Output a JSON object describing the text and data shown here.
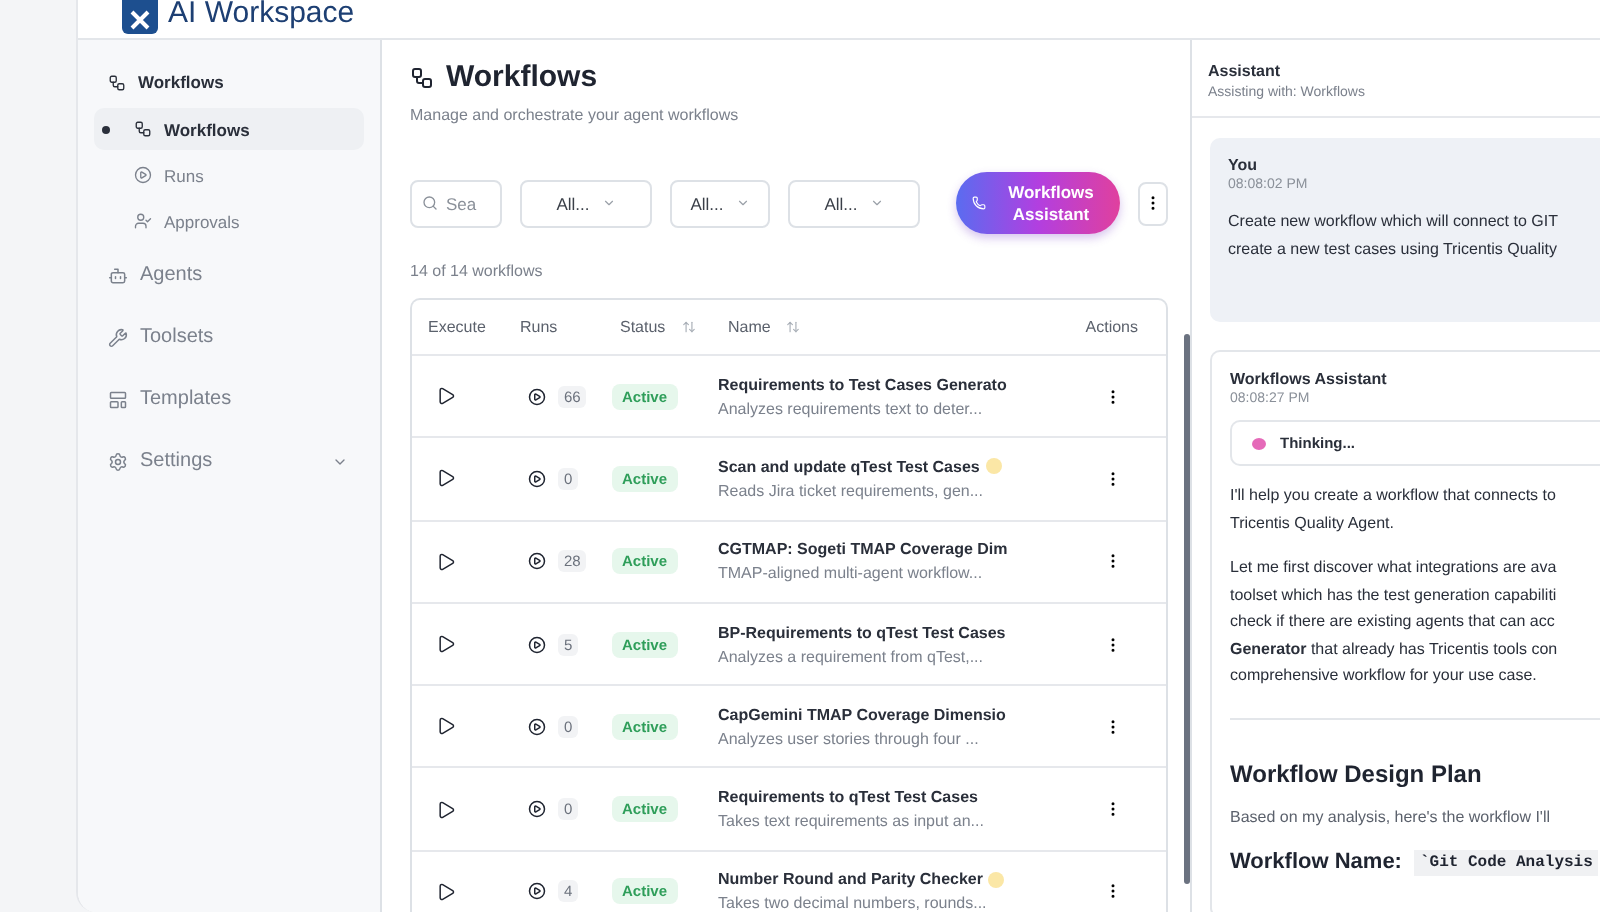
{
  "app": {
    "title": "AI Workspace"
  },
  "sidebar": {
    "items": [
      {
        "label": "Workflows",
        "children": [
          {
            "label": "Workflows",
            "selected": true
          },
          {
            "label": "Runs",
            "selected": false
          },
          {
            "label": "Approvals",
            "selected": false
          }
        ]
      },
      {
        "label": "Agents",
        "selected": false
      },
      {
        "label": "Toolsets",
        "selected": false
      },
      {
        "label": "Templates",
        "selected": false
      },
      {
        "label": "Settings",
        "selected": false,
        "expanded": false
      }
    ]
  },
  "main": {
    "title": "Workflows",
    "subtitle": "Manage and orchestrate your agent workflows",
    "search": {
      "placeholder": "Sea"
    },
    "filters": [
      "All...",
      "All...",
      "All..."
    ],
    "assistant_button": "Workflows Assistant",
    "count": "14 of 14 workflows",
    "table": {
      "columns": [
        {
          "label": "Execute",
          "sortable": false
        },
        {
          "label": "Runs",
          "sortable": false
        },
        {
          "label": "Status",
          "sortable": true
        },
        {
          "label": "Name",
          "sortable": true
        },
        {
          "label": "Actions",
          "sortable": false
        }
      ],
      "rows": [
        {
          "runs": "66",
          "status": "Active",
          "name": "Requirements to Test Cases Generato",
          "description": "Analyzes requirements text to deter...",
          "badge": false
        },
        {
          "runs": "0",
          "status": "Active",
          "name": "Scan and update qTest Test Cases",
          "description": "Reads Jira ticket requirements, gen...",
          "badge": true
        },
        {
          "runs": "28",
          "status": "Active",
          "name": "CGTMAP: Sogeti TMAP Coverage Dim",
          "description": "TMAP-aligned multi-agent workflow...",
          "badge": false
        },
        {
          "runs": "5",
          "status": "Active",
          "name": "BP-Requirements to qTest Test Cases",
          "description": "Analyzes a requirement from qTest,...",
          "badge": false
        },
        {
          "runs": "0",
          "status": "Active",
          "name": "CapGemini TMAP Coverage Dimensio",
          "description": "Analyzes user stories through four ...",
          "badge": false
        },
        {
          "runs": "0",
          "status": "Active",
          "name": "Requirements to qTest Test Cases",
          "description": "Takes text requirements as input an...",
          "badge": false
        },
        {
          "runs": "4",
          "status": "Active",
          "name": "Number Round and Parity Checker",
          "description": "Takes two decimal numbers, rounds...",
          "badge": true
        }
      ]
    }
  },
  "assistant": {
    "title": "Assistant",
    "subtitle": "Assisting with: Workflows",
    "messages": [
      {
        "kind": "user",
        "author": "You",
        "time": "08:08:02 PM",
        "lines": [
          "Create new workflow which will connect to GIT",
          "create a new test cases using Tricentis Quality"
        ]
      },
      {
        "kind": "assistant",
        "author": "Workflows Assistant",
        "time": "08:08:27 PM",
        "thinking": "Thinking...",
        "paragraphs": [
          [
            "I'll help you create a workflow that connects to",
            "Tricentis Quality Agent."
          ],
          [
            "Let me first discover what integrations are ava",
            "toolset which has the test generation capabiliti",
            "check if there are existing agents that can acc",
            "**Generator** that already has Tricentis tools con",
            "comprehensive workflow for your use case."
          ]
        ],
        "heading": "Workflow Design Plan",
        "intro": "Based on my analysis, here's the workflow I'll",
        "name_label": "Workflow Name:",
        "name_value": "`Git Code Analysis"
      }
    ]
  }
}
